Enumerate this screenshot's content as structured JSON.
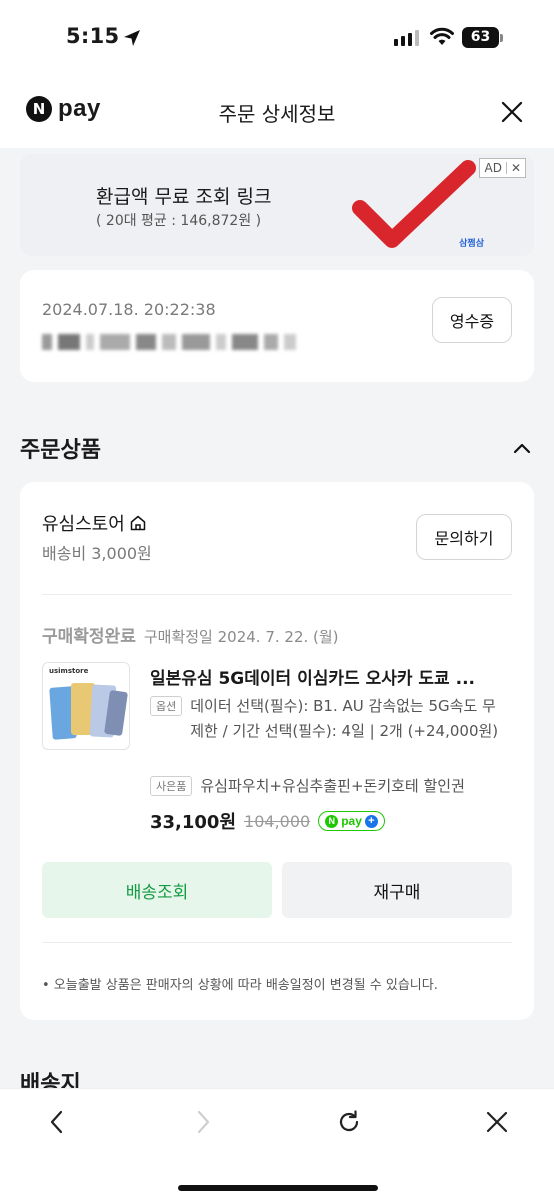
{
  "status_bar": {
    "time": "5:15",
    "battery": "63"
  },
  "header": {
    "logo_text": "pay",
    "logo_letter": "N",
    "title": "주문 상세정보"
  },
  "ad": {
    "title": "환급액 무료 조회 링크",
    "subtitle": "( 20대 평균 : 146,872원 )",
    "badge": "AD",
    "badge_close": "✕",
    "brand": "삼쩜삼"
  },
  "order": {
    "datetime": "2024.07.18. 20:22:38",
    "receipt_label": "영수증"
  },
  "section": {
    "title": "주문상품"
  },
  "store": {
    "name": "유심스토어",
    "shipping_fee": "배송비 3,000원",
    "inquiry_label": "문의하기"
  },
  "item": {
    "status": "구매확정완료",
    "confirm_date": "구매확정일 2024. 7. 22. (월)",
    "thumb_brand": "usimstore",
    "name": "일본유심 5G데이터 이심카드 오사카 도쿄 ...",
    "option_tag": "옵션",
    "option_text": "데이터 선택(필수): B1. AU 감속없는 5G속도 무제한 / 기간 선택(필수): 4일 | 2개 (+24,000원)",
    "gift_tag": "사은품",
    "gift_text": "유심파우치+유심추출핀+돈키호테 할인권",
    "price": "33,100원",
    "original_price": "104,000",
    "npay_badge": "pay"
  },
  "actions": {
    "track_label": "배송조회",
    "rebuy_label": "재구매"
  },
  "notice": "• 오늘출발 상품은 판매자의 상황에 따라 배송일정이 변경될 수 있습니다.",
  "next_section": "배송지",
  "colors": {
    "npay_green": "#1ec800",
    "track_green": "#139a43",
    "check_red": "#d8262c"
  }
}
